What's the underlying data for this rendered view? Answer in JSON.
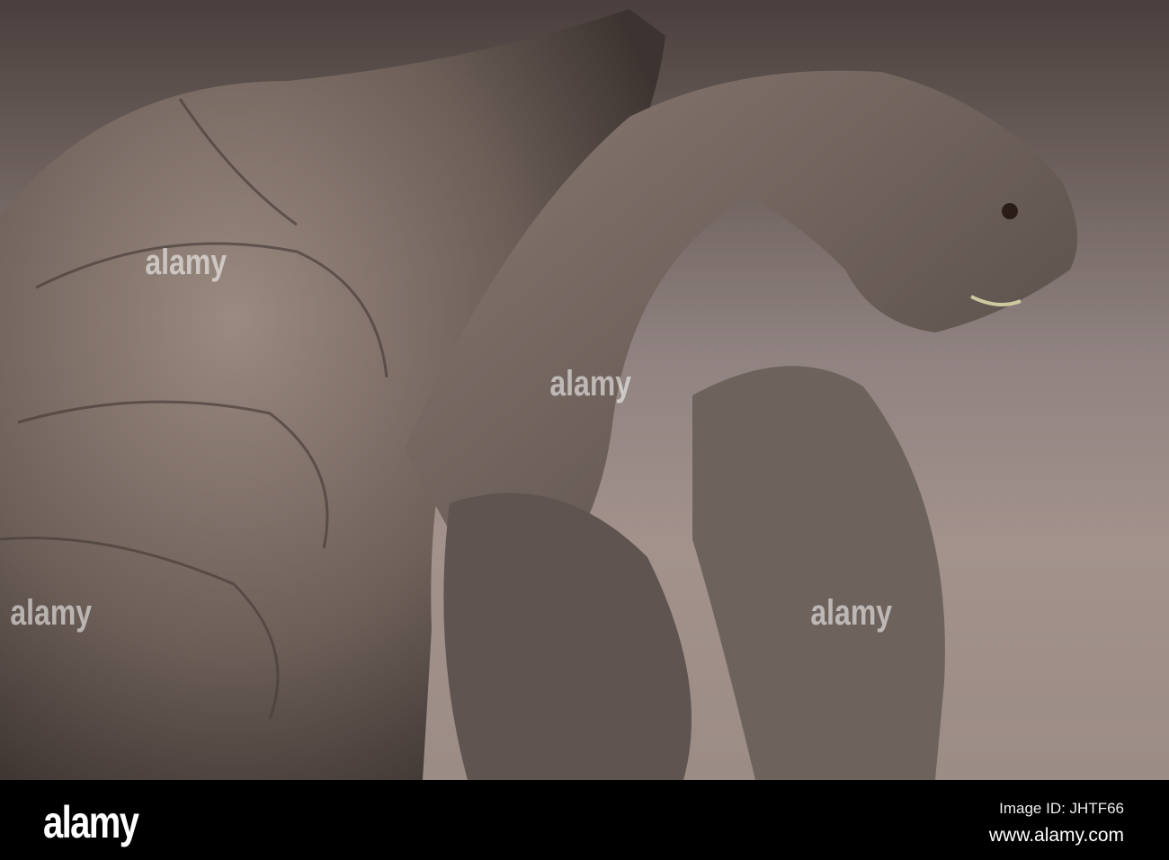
{
  "image": {
    "subject": "tortoise"
  },
  "watermark": {
    "text": "alamy"
  },
  "footer": {
    "logo": "alamy",
    "image_id": "Image ID: JHTF66",
    "url": "www.alamy.com"
  }
}
